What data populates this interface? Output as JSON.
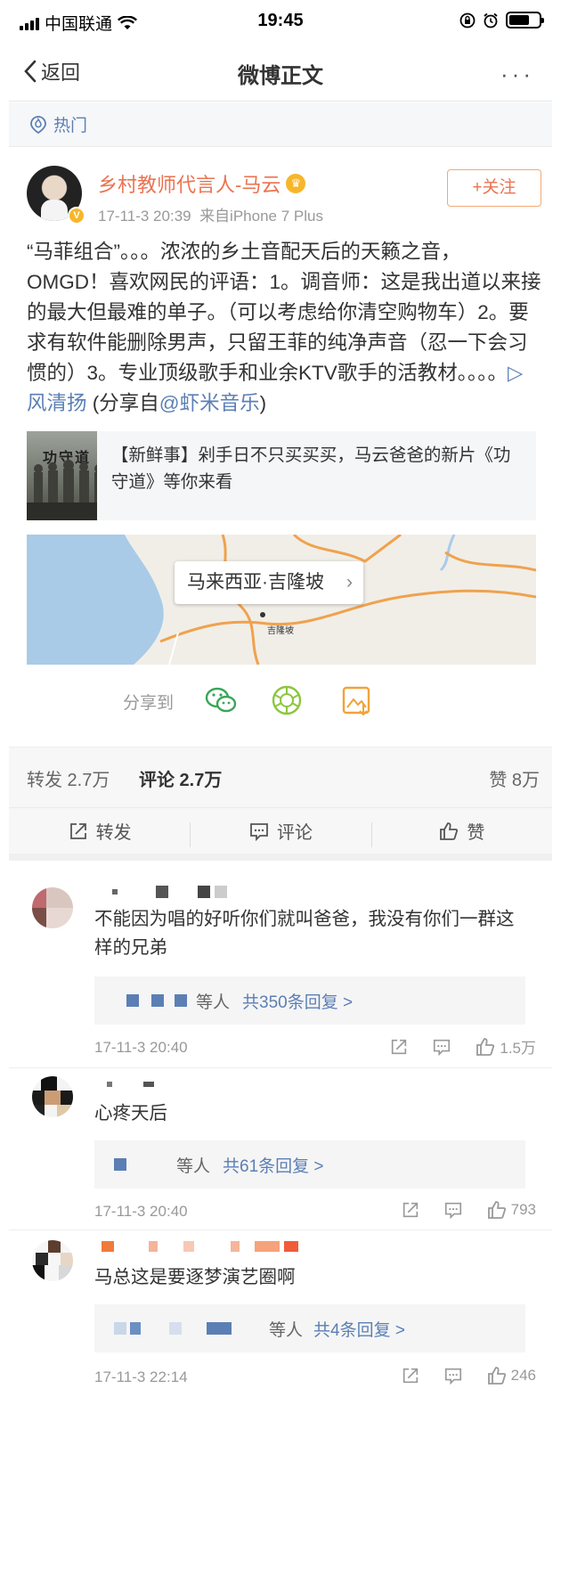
{
  "status_bar": {
    "carrier": "中国联通",
    "time": "19:45"
  },
  "nav": {
    "back_label": "返回",
    "title": "微博正文",
    "more_label": "···"
  },
  "hot": {
    "label": "热门"
  },
  "post": {
    "author": "乡村教师代言人-马云",
    "time": "17-11-3 20:39",
    "source": "来自iPhone 7 Plus",
    "follow_label": "+关注",
    "text_main": "“马菲组合”。。。浓浓的乡土音配天后的天籁之音，OMGD！喜欢网民的评语：1。调音师：这是我出道以来接的最大但最难的单子。（可以考虑给你清空购物车）2。要求有软件能删除男声，只留王菲的纯净声音（忍一下会习惯的）3。专业顶级歌手和业余KTV歌手的活教材。。。。",
    "music_link": "▷风清扬",
    "share_prefix": " (分享自",
    "share_link": "@虾米音乐",
    "share_suffix": ")",
    "card": {
      "image_title": "功守道",
      "text": "【新鲜事】剁手日不只买买买，马云爸爸的新片《功守道》等你来看"
    },
    "map": {
      "label": "马来西亚·吉隆坡",
      "city": "吉隆坡"
    },
    "share_label": "分享到"
  },
  "stats": {
    "repost": "转发 2.7万",
    "comment": "评论 2.7万",
    "like": "赞 8万"
  },
  "actions": {
    "repost": "转发",
    "comment": "评论",
    "like": "赞"
  },
  "comments": [
    {
      "text": "不能因为唱的好听你们就叫爸爸，我没有你们一群这样的兄弟",
      "replies_prefix": "等人",
      "replies_more": "共350条回复 >",
      "time": "17-11-3 20:40",
      "likes": "1.5万"
    },
    {
      "text": "心疼天后",
      "replies_prefix": "等人",
      "replies_more": "共61条回复 >",
      "time": "17-11-3 20:40",
      "likes": "793"
    },
    {
      "text": "马总这是要逐梦演艺圈啊",
      "replies_prefix": "等人",
      "replies_more": "共4条回复 >",
      "time": "17-11-3 22:14",
      "likes": "246"
    }
  ],
  "colors": {
    "accent_orange": "#eb7350",
    "link_blue": "#5b7fb4",
    "wechat_green": "#3aa657",
    "moments_green": "#8cc63f",
    "save_orange": "#f0a33a"
  }
}
